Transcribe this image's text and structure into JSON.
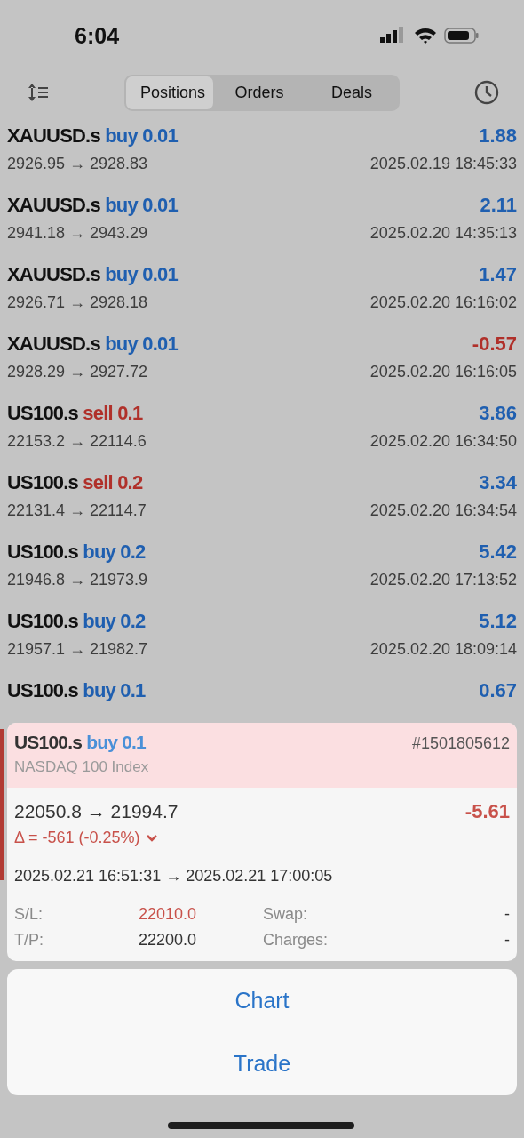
{
  "status_bar": {
    "time": "6:04"
  },
  "tabs": [
    {
      "label": "Positions",
      "selected": true
    },
    {
      "label": "Orders",
      "selected": false
    },
    {
      "label": "Deals",
      "selected": false
    }
  ],
  "positions": [
    {
      "symbol": "XAUUSD.s",
      "side": "buy",
      "volume": "0.01",
      "profit": "1.88",
      "negative": false,
      "prices": "2926.95 → 2928.83",
      "time": "2025.02.19 18:45:33"
    },
    {
      "symbol": "XAUUSD.s",
      "side": "buy",
      "volume": "0.01",
      "profit": "2.11",
      "negative": false,
      "prices": "2941.18 → 2943.29",
      "time": "2025.02.20 14:35:13"
    },
    {
      "symbol": "XAUUSD.s",
      "side": "buy",
      "volume": "0.01",
      "profit": "1.47",
      "negative": false,
      "prices": "2926.71 → 2928.18",
      "time": "2025.02.20 16:16:02"
    },
    {
      "symbol": "XAUUSD.s",
      "side": "buy",
      "volume": "0.01",
      "profit": "-0.57",
      "negative": true,
      "prices": "2928.29 → 2927.72",
      "time": "2025.02.20 16:16:05"
    },
    {
      "symbol": "US100.s",
      "side": "sell",
      "volume": "0.1",
      "profit": "3.86",
      "negative": false,
      "prices": "22153.2 → 22114.6",
      "time": "2025.02.20 16:34:50"
    },
    {
      "symbol": "US100.s",
      "side": "sell",
      "volume": "0.2",
      "profit": "3.34",
      "negative": false,
      "prices": "22131.4 → 22114.7",
      "time": "2025.02.20 16:34:54"
    },
    {
      "symbol": "US100.s",
      "side": "buy",
      "volume": "0.2",
      "profit": "5.42",
      "negative": false,
      "prices": "21946.8 → 21973.9",
      "time": "2025.02.20 17:13:52"
    },
    {
      "symbol": "US100.s",
      "side": "buy",
      "volume": "0.2",
      "profit": "5.12",
      "negative": false,
      "prices": "21957.1 → 21982.7",
      "time": "2025.02.20 18:09:14"
    },
    {
      "symbol": "US100.s",
      "side": "buy",
      "volume": "0.1",
      "profit": "0.67",
      "negative": false
    }
  ],
  "detail": {
    "symbol": "US100.s",
    "side": "buy",
    "volume": "0.1",
    "ticket": "#1501805612",
    "description": "NASDAQ 100 Index",
    "prices": "22050.8 → 21994.7",
    "profit": "-5.61",
    "negative": true,
    "delta": "Δ = -561 (-0.25%)",
    "expanded": false,
    "times": "2025.02.21 16:51:31 → 2025.02.21 17:00:05",
    "fields": [
      {
        "label": "S/L:",
        "value": "22010.0",
        "color": "#c8514a"
      },
      {
        "label": "Swap:",
        "value": "-",
        "color": "#333333"
      },
      {
        "label": "T/P:",
        "value": "22200.0",
        "color": "#333333"
      },
      {
        "label": "Charges:",
        "value": "-",
        "color": "#333333"
      }
    ]
  },
  "actions": [
    "Chart",
    "Trade"
  ]
}
